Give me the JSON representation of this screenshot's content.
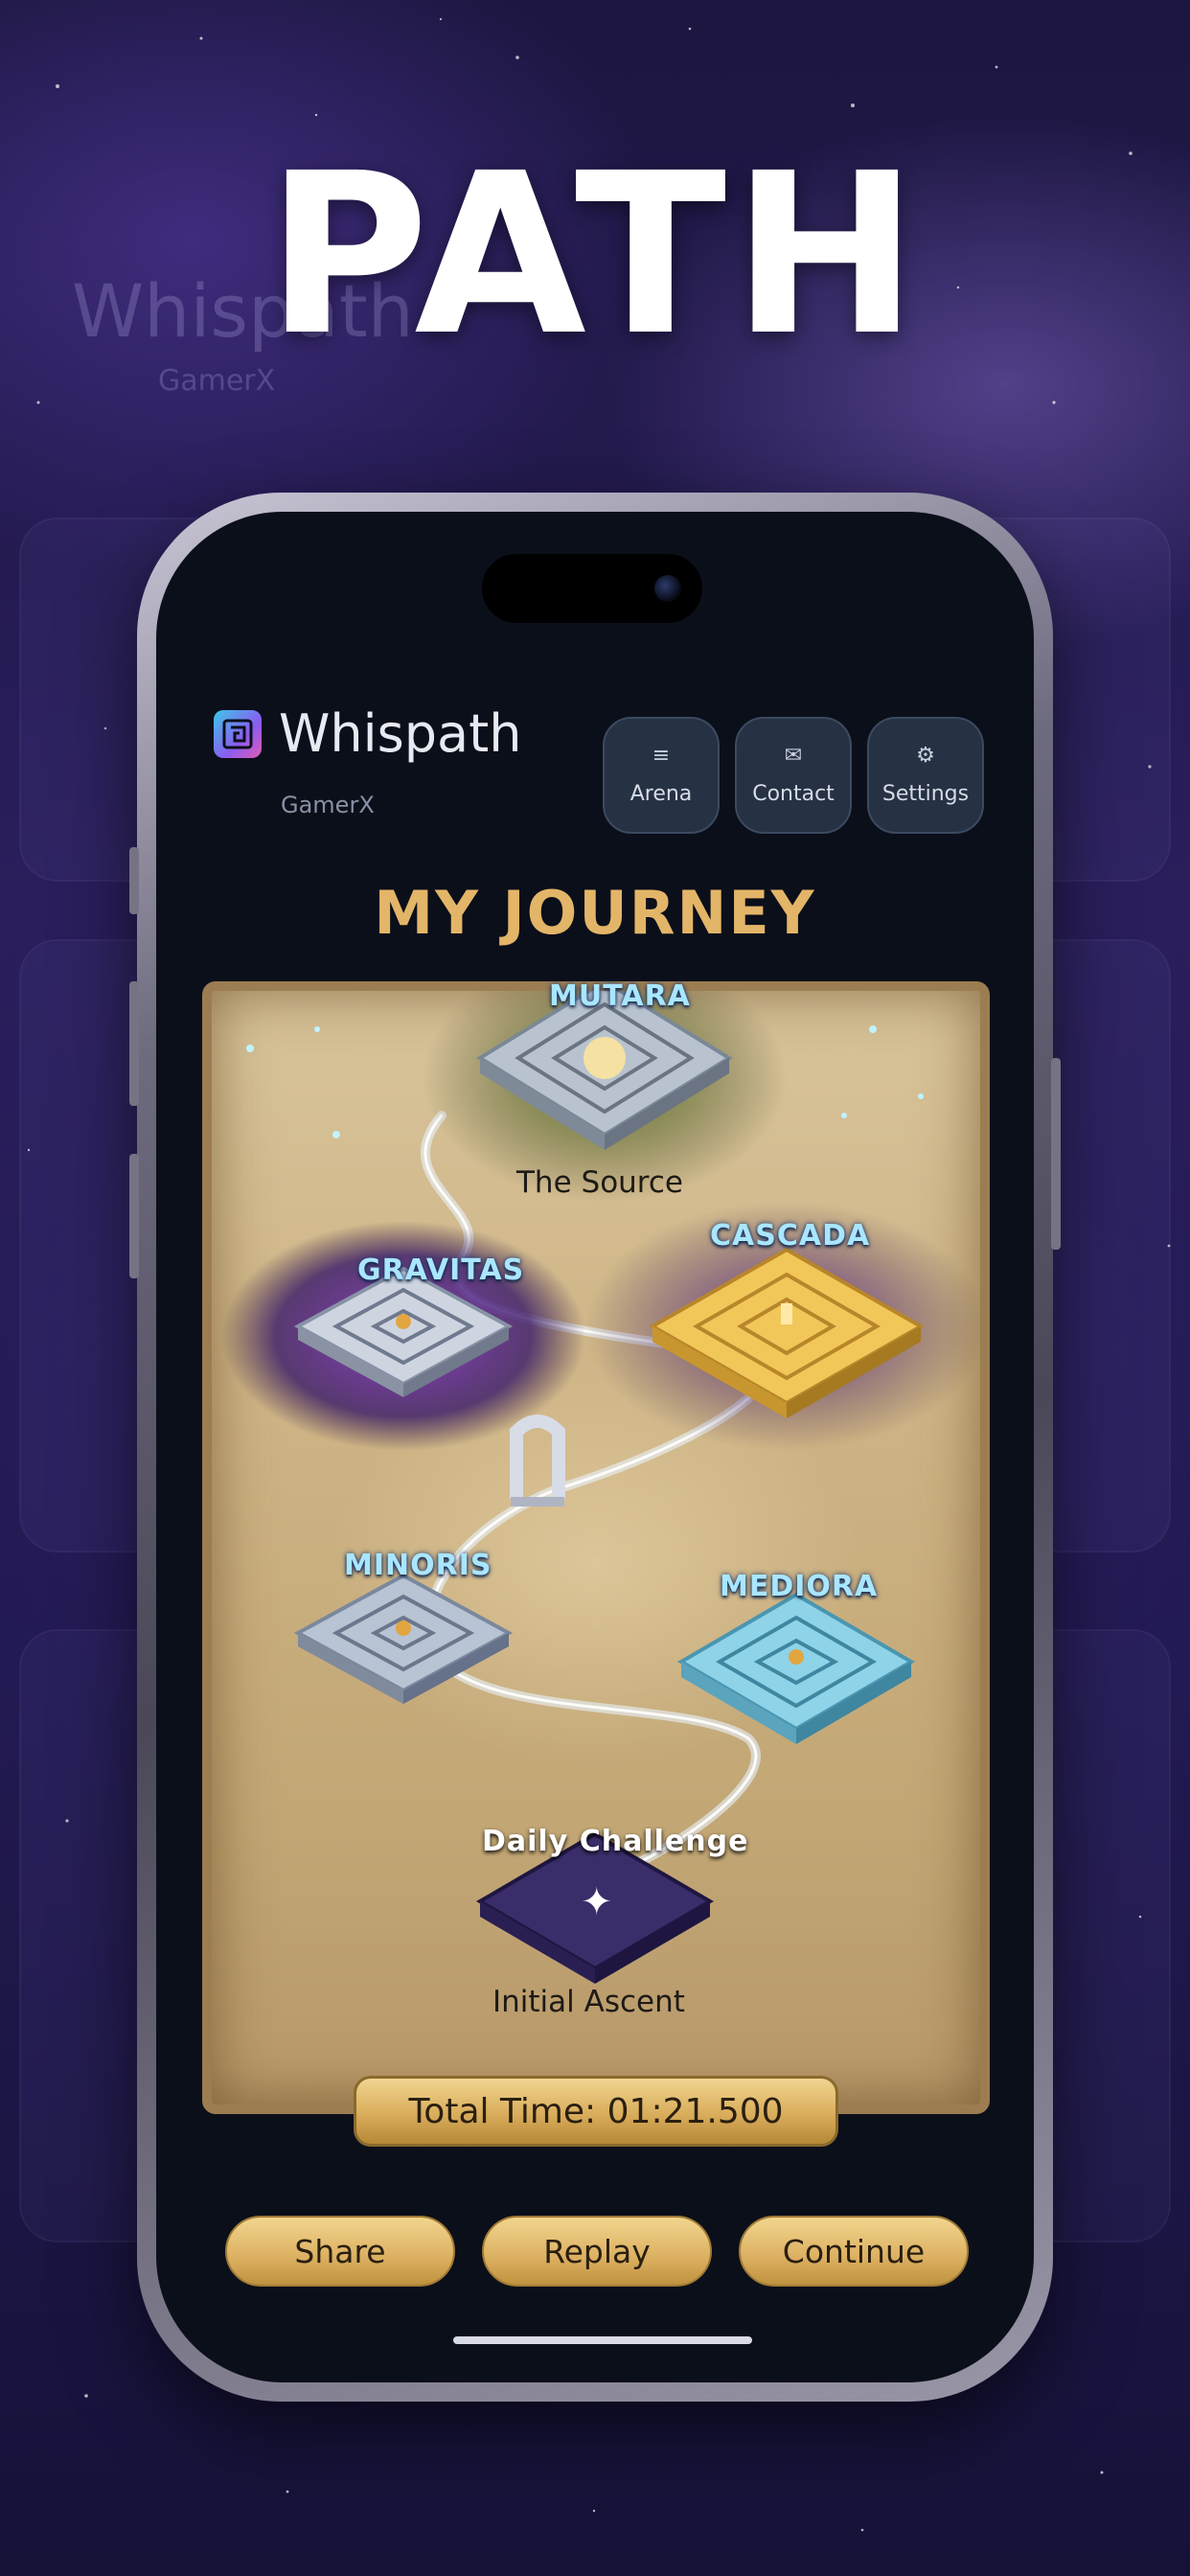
{
  "headline": "PATH",
  "background_ghost": {
    "brand": "Whispath",
    "user": "GamerX"
  },
  "app": {
    "name": "Whispath",
    "user": "GamerX"
  },
  "nav": [
    {
      "label": "Arena",
      "icon": "menu-icon"
    },
    {
      "label": "Contact",
      "icon": "mail-icon"
    },
    {
      "label": "Settings",
      "icon": "gear-icon"
    }
  ],
  "journey_title": "MY JOURNEY",
  "levels": {
    "mutara": "MUTARA",
    "gravitas": "GRAVITAS",
    "cascada": "CASCADA",
    "minoris": "MINORIS",
    "mediora": "MEDIORA",
    "daily": "Daily Challenge"
  },
  "stages": {
    "top": "The Source",
    "bottom": "Initial Ascent"
  },
  "total_time": "Total Time: 01:21.500",
  "actions": {
    "share": "Share",
    "replay": "Replay",
    "continue": "Continue"
  },
  "colors": {
    "gold": "#e3b568",
    "panel": "#263244",
    "screen": "#0b0f1a",
    "glow": "#a9e6ff"
  }
}
